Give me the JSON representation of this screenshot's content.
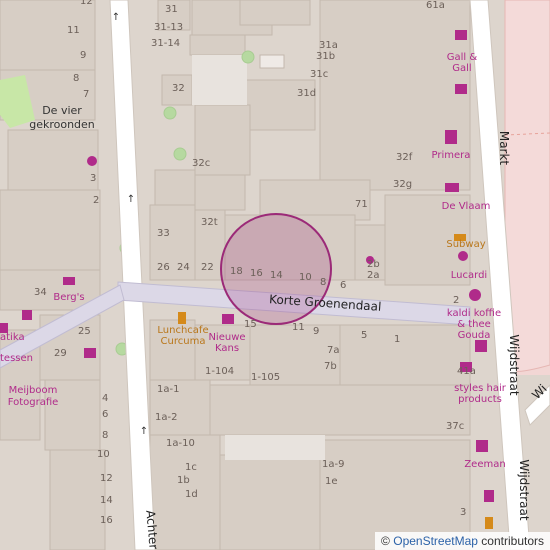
{
  "map": {
    "streets": {
      "korte_groenendaal": "Korte Groenendaal",
      "markt": "Markt",
      "wijdstraat_1": "Wijdstraat",
      "wijdstraat_2": "Wijdstraat",
      "achter": "Achter",
      "wi": "Wi"
    },
    "neighborhood": {
      "line1": "De vier",
      "line2": "gekroonden"
    },
    "pois": {
      "gall": {
        "line1": "Gall &",
        "line2": "Gall"
      },
      "primera": "Primera",
      "de_vlaam": "De Vlaam",
      "subway": "Subway",
      "lucardi": "Lucardi",
      "kaldi": {
        "line1": "kaldi koffie",
        "line2": "& thee",
        "line3": "Gouda"
      },
      "styles": {
        "line1": "styles hair",
        "line2": "products"
      },
      "zeeman": "Zeeman",
      "bergs": "Berg's",
      "lunchcafe": {
        "line1": "Lunchcafe",
        "line2": "Curcuma"
      },
      "nieuwe_kans": {
        "line1": "Nieuwe",
        "line2": "Kans"
      },
      "meijboom": {
        "line1": "Meijboom",
        "line2": "Fotografie"
      },
      "atika": {
        "line1": "atika",
        "line2": "tessen"
      }
    },
    "house_numbers": {
      "n12": "12",
      "n11": "11",
      "n9": "9",
      "n8": "8",
      "n7": "7",
      "n3": "3",
      "n2": "2",
      "n31": "31",
      "n31_13": "31-13",
      "n31_14": "31-14",
      "n31a": "31a",
      "n31b": "31b",
      "n31c": "31c",
      "n32": "32",
      "n31d": "31d",
      "n32c": "32c",
      "n32f": "32f",
      "n32g": "32g",
      "n71": "71",
      "n32t": "32t",
      "n33": "33",
      "n26": "26",
      "n24": "24",
      "n22": "22",
      "n18": "18",
      "n16": "16",
      "n14": "14",
      "n10": "10",
      "n8b": "8",
      "n6": "6",
      "n2b": "2b",
      "n2a": "2a",
      "n2c": "2",
      "n34": "34",
      "n61a": "61a",
      "n25": "25",
      "n29": "29",
      "n15": "15",
      "n11b": "11",
      "n9b": "9",
      "n7a": "7a",
      "n7b": "7b",
      "n5": "5",
      "n1": "1",
      "n41a": "41a",
      "n1_104": "1-104",
      "n1_105": "1-105",
      "n1a_1": "1a-1",
      "n1a_2": "1a-2",
      "n4": "4",
      "n6b": "6",
      "n8c": "8",
      "n10b": "10",
      "n12b": "12",
      "n14b": "14",
      "n16b": "16",
      "n1a_10": "1a-10",
      "n1c": "1c",
      "n1b": "1b",
      "n1d": "1d",
      "n37c": "37c",
      "n1a_9": "1a-9",
      "n1e": "1e",
      "n3b": "3"
    },
    "highlight_color": "#9b2a78"
  },
  "attribution": {
    "symbol": "©",
    "link": "OpenStreetMap",
    "suffix": "contributors"
  }
}
